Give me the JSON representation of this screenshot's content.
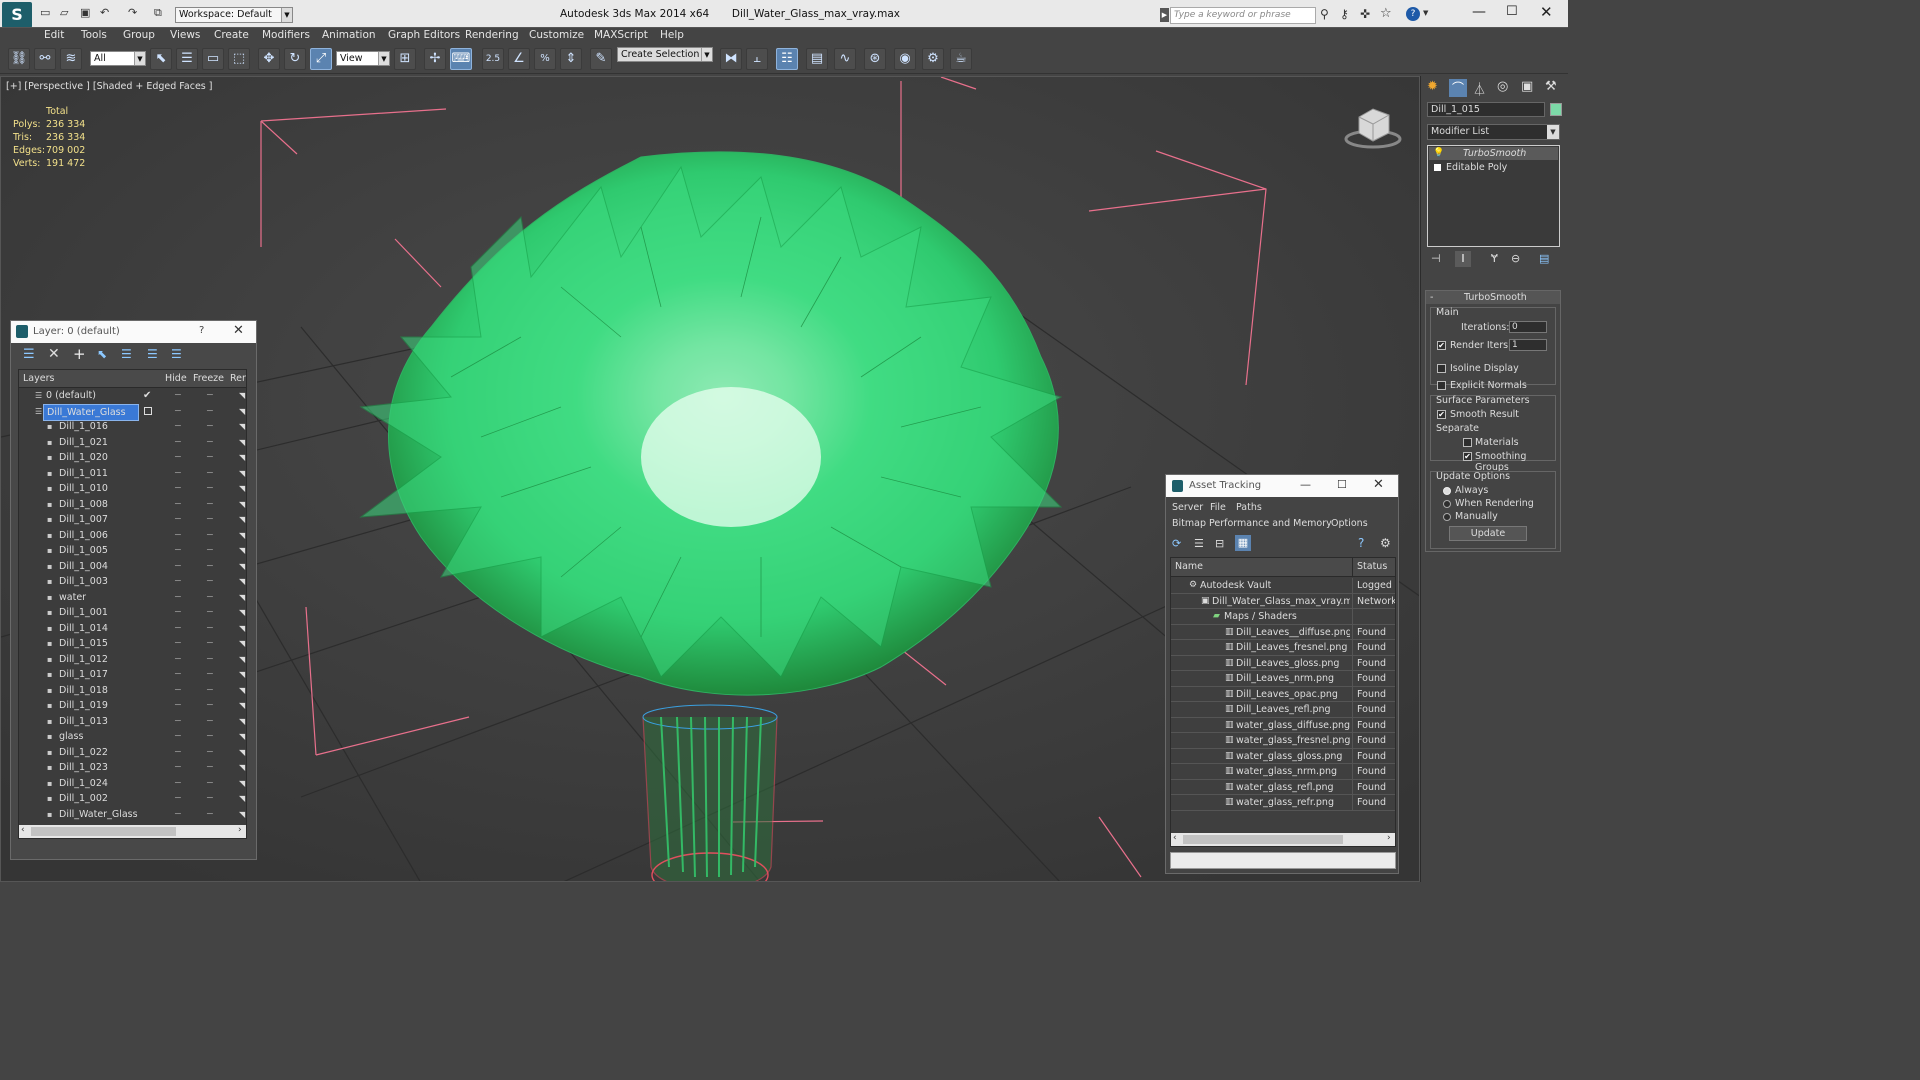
{
  "title": {
    "app": "Autodesk 3ds Max  2014 x64",
    "file": "Dill_Water_Glass_max_vray.max",
    "workspace": "Workspace: Default",
    "search_placeholder": "Type a keyword or phrase"
  },
  "menu": [
    "Edit",
    "Tools",
    "Group",
    "Views",
    "Create",
    "Modifiers",
    "Animation",
    "Graph Editors",
    "Rendering",
    "Customize",
    "MAXScript",
    "Help"
  ],
  "toolbar": {
    "selection_filter": "All",
    "ref_coord": "View",
    "snap_angle": "2.5",
    "named_selection": "Create Selection Se"
  },
  "viewport": {
    "label": "[+] [Perspective ] [Shaded + Edged Faces ]",
    "stats_header": "Total",
    "stats": [
      {
        "k": "Polys:",
        "v": "236 334"
      },
      {
        "k": "Tris:",
        "v": "236 334"
      },
      {
        "k": "Edges:",
        "v": "709 002"
      },
      {
        "k": "Verts:",
        "v": "191 472"
      }
    ]
  },
  "layer_window": {
    "title": "Layer: 0 (default)",
    "help": "?",
    "columns": [
      "Layers",
      "Hide",
      "Freeze",
      "Ren"
    ],
    "rows": [
      {
        "name": "0 (default)",
        "level": 0,
        "kind": "layer"
      },
      {
        "name": "Dill_Water_Glass",
        "level": 0,
        "kind": "layer",
        "selected": true
      },
      {
        "name": "Dill_1_016",
        "level": 1
      },
      {
        "name": "Dill_1_021",
        "level": 1
      },
      {
        "name": "Dill_1_020",
        "level": 1
      },
      {
        "name": "Dill_1_011",
        "level": 1
      },
      {
        "name": "Dill_1_010",
        "level": 1
      },
      {
        "name": "Dill_1_008",
        "level": 1
      },
      {
        "name": "Dill_1_007",
        "level": 1
      },
      {
        "name": "Dill_1_006",
        "level": 1
      },
      {
        "name": "Dill_1_005",
        "level": 1
      },
      {
        "name": "Dill_1_004",
        "level": 1
      },
      {
        "name": "Dill_1_003",
        "level": 1
      },
      {
        "name": "water",
        "level": 1
      },
      {
        "name": "Dill_1_001",
        "level": 1
      },
      {
        "name": "Dill_1_014",
        "level": 1
      },
      {
        "name": "Dill_1_015",
        "level": 1
      },
      {
        "name": "Dill_1_012",
        "level": 1
      },
      {
        "name": "Dill_1_017",
        "level": 1
      },
      {
        "name": "Dill_1_018",
        "level": 1
      },
      {
        "name": "Dill_1_019",
        "level": 1
      },
      {
        "name": "Dill_1_013",
        "level": 1
      },
      {
        "name": "glass",
        "level": 1
      },
      {
        "name": "Dill_1_022",
        "level": 1
      },
      {
        "name": "Dill_1_023",
        "level": 1
      },
      {
        "name": "Dill_1_024",
        "level": 1
      },
      {
        "name": "Dill_1_002",
        "level": 1
      },
      {
        "name": "Dill_Water_Glass",
        "level": 1
      }
    ]
  },
  "asset_window": {
    "title": "Asset Tracking",
    "menu": [
      "Server",
      "File",
      "Paths"
    ],
    "menu2": [
      "Bitmap Performance and Memory",
      "Options"
    ],
    "columns": [
      "Name",
      "Status"
    ],
    "rows": [
      {
        "name": "Autodesk Vault",
        "status": "Logged",
        "level": 0
      },
      {
        "name": "Dill_Water_Glass_max_vray.max",
        "status": "Network",
        "level": 1
      },
      {
        "name": "Maps / Shaders",
        "status": "",
        "level": 2
      },
      {
        "name": "Dill_Leaves__diffuse.png",
        "status": "Found",
        "level": 3
      },
      {
        "name": "Dill_Leaves_fresnel.png",
        "status": "Found",
        "level": 3
      },
      {
        "name": "Dill_Leaves_gloss.png",
        "status": "Found",
        "level": 3
      },
      {
        "name": "Dill_Leaves_nrm.png",
        "status": "Found",
        "level": 3
      },
      {
        "name": "Dill_Leaves_opac.png",
        "status": "Found",
        "level": 3
      },
      {
        "name": "Dill_Leaves_refl.png",
        "status": "Found",
        "level": 3
      },
      {
        "name": "water_glass_diffuse.png",
        "status": "Found",
        "level": 3
      },
      {
        "name": "water_glass_fresnel.png",
        "status": "Found",
        "level": 3
      },
      {
        "name": "water_glass_gloss.png",
        "status": "Found",
        "level": 3
      },
      {
        "name": "water_glass_nrm.png",
        "status": "Found",
        "level": 3
      },
      {
        "name": "water_glass_refl.png",
        "status": "Found",
        "level": 3
      },
      {
        "name": "water_glass_refr.png",
        "status": "Found",
        "level": 3
      }
    ]
  },
  "command_panel": {
    "object_name": "Dill_1_015",
    "object_color": "#7dd9a8",
    "modifier_list": "Modifier List",
    "stack": [
      "TurboSmooth",
      "Editable Poly"
    ],
    "rollout_title": "TurboSmooth",
    "main_label": "Main",
    "iterations_label": "Iterations:",
    "iterations_value": "0",
    "render_iters_label": "Render Iters:",
    "render_iters_value": "1",
    "render_iters_checked": true,
    "isoline_label": "Isoline Display",
    "explicit_normals_label": "Explicit Normals",
    "surface_params_label": "Surface Parameters",
    "smooth_result_label": "Smooth Result",
    "separate_label": "Separate",
    "materials_label": "Materials",
    "smoothing_groups_label": "Smoothing Groups",
    "update_options_label": "Update Options",
    "update_always": "Always",
    "update_when_rendering": "When Rendering",
    "update_manually": "Manually",
    "update_button": "Update"
  },
  "colors": {
    "foliage": "#3fe08a",
    "bounding_box": "#e8708c",
    "selection": "#3a79d6"
  }
}
